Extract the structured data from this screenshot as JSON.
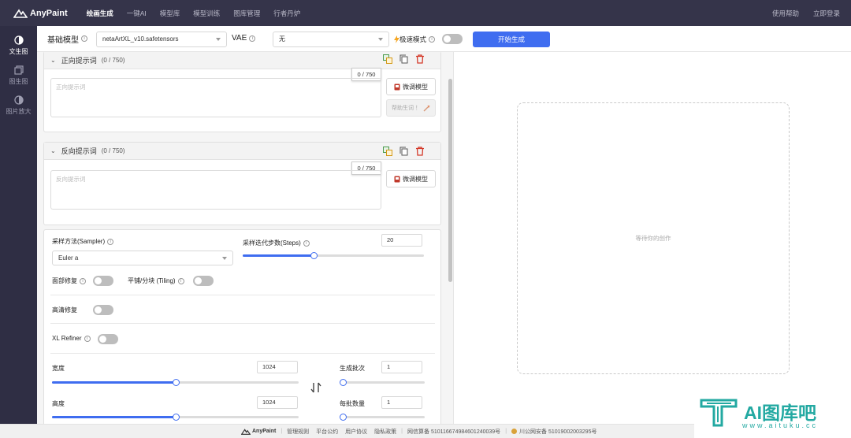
{
  "topnav": {
    "brand": "AnyPaint",
    "items": [
      "绘画生成",
      "一键AI",
      "模型库",
      "模型训练",
      "图库管理",
      "行者丹炉"
    ],
    "right": [
      "使用帮助",
      "立即登录"
    ]
  },
  "sidebar": {
    "items": [
      {
        "label": "文生图",
        "icon": "half-circle-icon"
      },
      {
        "label": "图生图",
        "icon": "image-stack-icon"
      },
      {
        "label": "图片放大",
        "icon": "half-circle-icon"
      }
    ]
  },
  "toolbar": {
    "base_model_label": "基础模型",
    "base_model_value": "netaArtXL_v10.safetensors",
    "vae_label": "VAE",
    "vae_value": "无",
    "fast_mode_label": "极速模式",
    "start_label": "开始生成"
  },
  "positive": {
    "title": "正向提示词",
    "count": "(0 / 750)",
    "counter": "0 / 750",
    "placeholder": "正向提示词",
    "finetune_label": "微调模型",
    "smart_label": "帮助生词 ！"
  },
  "negative": {
    "title": "反向提示词",
    "count": "(0 / 750)",
    "counter": "0 / 750",
    "placeholder": "反向提示词",
    "finetune_label": "微调模型"
  },
  "settings": {
    "sampler_label": "采样方法(Sampler)",
    "sampler_value": "Euler a",
    "steps_label": "采样迭代步数(Steps)",
    "steps_value": "20",
    "steps_fraction": 0.39,
    "face_fix_label": "面部修复",
    "tiling_label": "平铺/分块 (Tiling)",
    "hires_label": "高清修复",
    "refiner_label": "XL Refiner",
    "width_label": "宽度",
    "width_value": "1024",
    "width_fraction": 0.5,
    "height_label": "高度",
    "height_value": "1024",
    "height_fraction": 0.5,
    "batch_count_label": "生成批次",
    "batch_count_value": "1",
    "batch_count_fraction": 0.0,
    "batch_size_label": "每批数量",
    "batch_size_value": "1",
    "batch_size_fraction": 0.0
  },
  "preview": {
    "placeholder": "等待你的创作"
  },
  "footer": {
    "brand": "AnyPaint",
    "links": [
      "管理规则",
      "平台公约",
      "用户协议",
      "隐私政策"
    ],
    "icp": "网信算备 510116674984601240039号",
    "police": "川公网安备 51019002003295号"
  },
  "watermark": {
    "text": "AI图库吧",
    "url": "www.aituku.cc"
  },
  "colors": {
    "nav_bg": "#35344a",
    "sidebar_bg": "#2f2e44",
    "accent": "#3f6df0",
    "watermark": "#23a9a2"
  }
}
